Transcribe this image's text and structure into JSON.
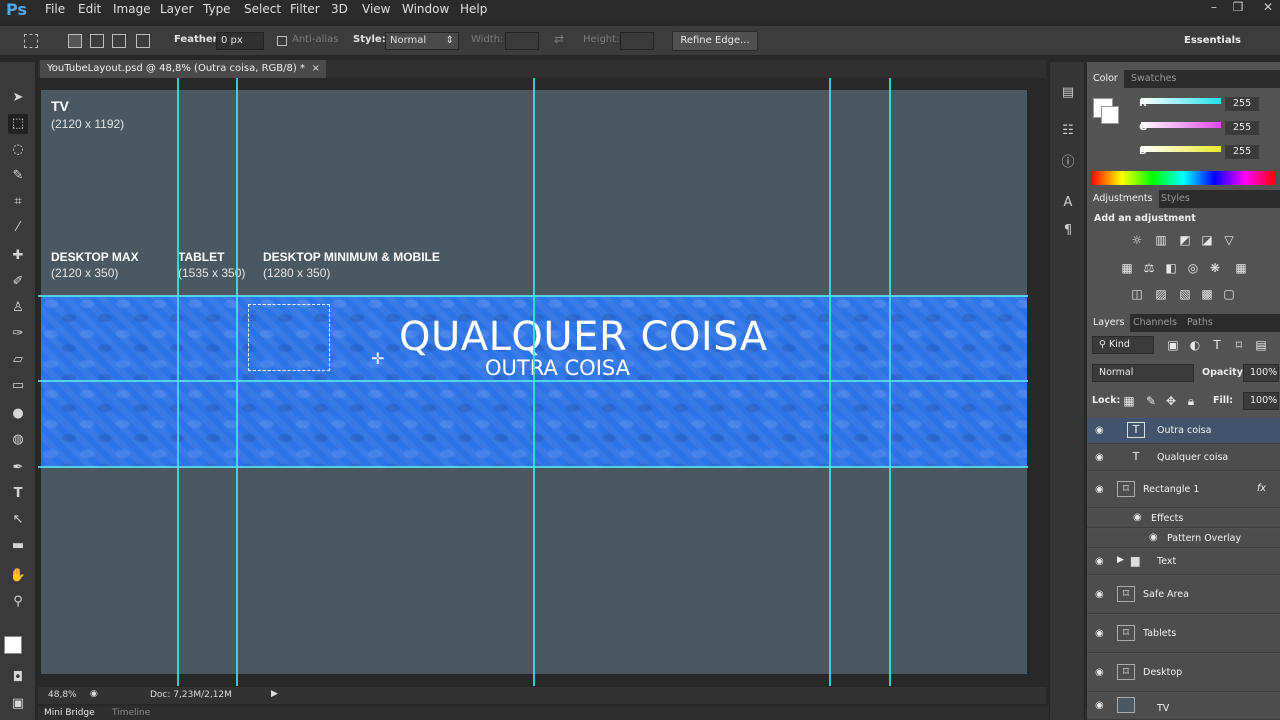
{
  "app": {
    "logo": "Ps",
    "menu": [
      "File",
      "Edit",
      "Image",
      "Layer",
      "Type",
      "Select",
      "Filter",
      "3D",
      "View",
      "Window",
      "Help"
    ],
    "window_controls": [
      "minimize-icon",
      "restore-icon",
      "close-icon"
    ]
  },
  "options": {
    "feather_label": "Feather:",
    "feather_value": "0 px",
    "antialias_label": "Anti-alias",
    "style_label": "Style:",
    "style_value": "Normal",
    "width_label": "Width:",
    "height_label": "Height:",
    "refine_label": "Refine Edge...",
    "workspace": "Essentials"
  },
  "document": {
    "tab_title": "YouTubeLayout.psd @ 48,8% (Outra coisa, RGB/8) *",
    "tab_close": "×",
    "zoom": "48,8%",
    "doc_size": "Doc: 7,23M/2,12M"
  },
  "canvas": {
    "tv_title": "TV",
    "tv_size": "(2120 x 1192)",
    "desktop_max_title": "DESKTOP MAX",
    "desktop_max_size": "(2120 x 350)",
    "tablet_title": "TABLET",
    "tablet_size": "(1535 x 350)",
    "desktop_min_title": "DESKTOP MINIMUM & MOBILE",
    "desktop_min_size": "(1280 x 350)",
    "banner_title": "QUALQUER COISA",
    "banner_subtitle": "OUTRA COISA",
    "banner_color": "#2d74e6",
    "guide_color": "#3ee6e6"
  },
  "bottom_tabs": [
    "Mini Bridge",
    "Timeline"
  ],
  "color_panel": {
    "tabs": [
      "Color",
      "Swatches"
    ],
    "channels": [
      {
        "label": "R",
        "value": "255",
        "color": "#23e0ee"
      },
      {
        "label": "G",
        "value": "255",
        "color": "#e04ae8"
      },
      {
        "label": "B",
        "value": "255",
        "color": "#eaea2c"
      }
    ]
  },
  "adjustments_panel": {
    "tabs": [
      "Adjustments",
      "Styles"
    ],
    "heading": "Add an adjustment"
  },
  "layers_panel": {
    "tabs": [
      "Layers",
      "Channels",
      "Paths"
    ],
    "filter_kind": "Kind",
    "blend_mode": "Normal",
    "opacity_label": "Opacity:",
    "opacity_value": "100%",
    "lock_label": "Lock:",
    "fill_label": "Fill:",
    "fill_value": "100%",
    "layers": [
      {
        "name": "Outra coisa",
        "kind": "T"
      },
      {
        "name": "Qualquer coisa",
        "kind": "T"
      },
      {
        "name": "Rectangle 1",
        "kind": "shape",
        "fx": "fx"
      },
      {
        "name": "Effects"
      },
      {
        "name": "Pattern Overlay"
      },
      {
        "name": "Text",
        "kind": "group"
      },
      {
        "name": "Safe Area",
        "kind": "shape"
      },
      {
        "name": "Tablets",
        "kind": "shape"
      },
      {
        "name": "Desktop",
        "kind": "shape"
      },
      {
        "name": "TV",
        "kind": "shape"
      }
    ]
  }
}
